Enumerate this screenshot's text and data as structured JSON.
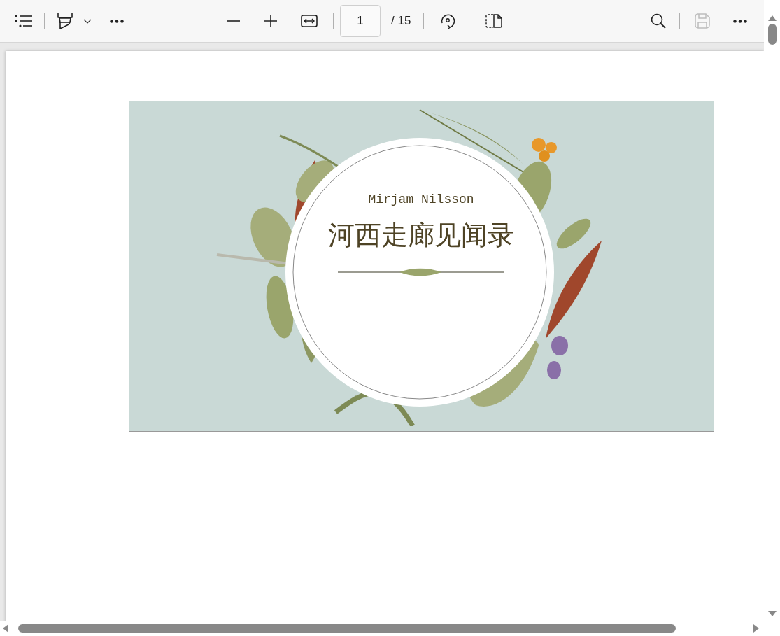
{
  "toolbar": {
    "page_input": {
      "value": "1"
    },
    "page_count": "/ 15",
    "save_disabled": true
  },
  "slide": {
    "author": "Mirjam Nilsson",
    "title": "河西走廊见闻录"
  }
}
